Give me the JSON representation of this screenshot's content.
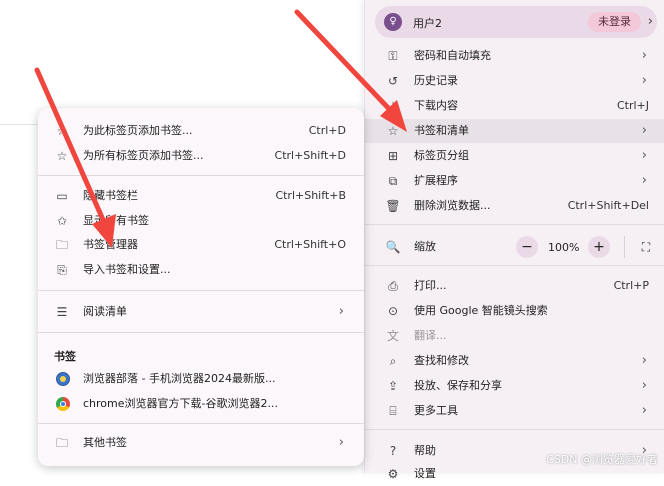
{
  "profile": {
    "avatar_glyph": "♀",
    "name": "用户2",
    "badge": "未登录"
  },
  "menu": {
    "passwords": "密码和自动填充",
    "history": "历史记录",
    "downloads": {
      "label": "下载内容",
      "shortcut": "Ctrl+J"
    },
    "bookmarks": "书签和清单",
    "tab_groups": "标签页分组",
    "extensions": "扩展程序",
    "clear_data": {
      "label": "删除浏览数据...",
      "shortcut": "Ctrl+Shift+Del"
    },
    "zoom": {
      "label": "缩放",
      "value": "100%",
      "minus": "−",
      "plus": "+"
    },
    "print": {
      "label": "打印...",
      "shortcut": "Ctrl+P"
    },
    "lens": "使用 Google 智能镜头搜索",
    "translate": "翻译...",
    "find": "查找和修改",
    "cast": "投放、保存和分享",
    "more_tools": "更多工具",
    "help": "帮助",
    "settings": "设置"
  },
  "submenu": {
    "add_tab": {
      "label": "为此标签页添加书签...",
      "shortcut": "Ctrl+D"
    },
    "add_all": {
      "label": "为所有标签页添加书签...",
      "shortcut": "Ctrl+Shift+D"
    },
    "hide_bar": {
      "label": "隐藏书签栏",
      "shortcut": "Ctrl+Shift+B"
    },
    "show_all": "显示所有书签",
    "manager": {
      "label": "书签管理器",
      "shortcut": "Ctrl+Shift+O"
    },
    "import": "导入书签和设置...",
    "reading_list": "阅读清单",
    "section": "书签",
    "bookmarks": [
      "浏览器部落 - 手机浏览器2024最新版...",
      "chrome浏览器官方下载-谷歌浏览器2..."
    ],
    "other": "其他书签"
  },
  "watermark": "CSDN @浏览器爱好者",
  "colors": {
    "arrow": "#f0463e",
    "highlight": "#e8e1e7",
    "profile_bg": "#ead9e6"
  }
}
